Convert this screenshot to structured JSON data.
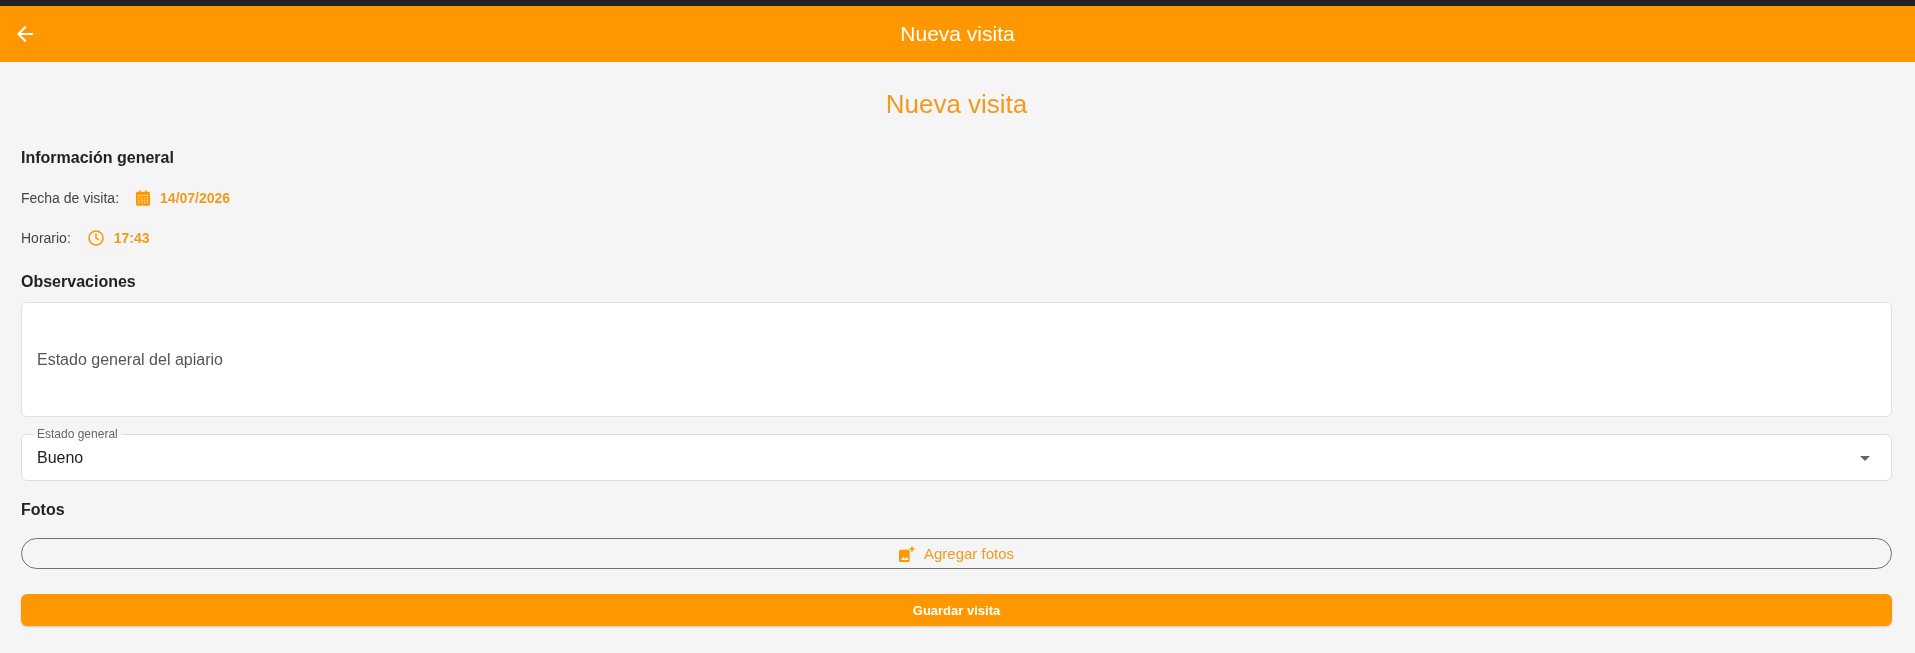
{
  "app_bar": {
    "title": "Nueva visita"
  },
  "page_title": "Nueva visita",
  "general_info": {
    "heading": "Información general",
    "fields": [
      {
        "kind": "date",
        "label": "Fecha de visita:",
        "value": "14/07/2026"
      },
      {
        "kind": "time",
        "label": "Horario:",
        "value": "17:43"
      }
    ]
  },
  "observations": {
    "heading": "Observaciones",
    "placeholder": "Estado general del apiario"
  },
  "general_state": {
    "label": "Estado general",
    "value": "Bueno"
  },
  "photos": {
    "heading": "Fotos",
    "add_button": "Agregar fotos"
  },
  "save_button": "Guardar visita"
}
